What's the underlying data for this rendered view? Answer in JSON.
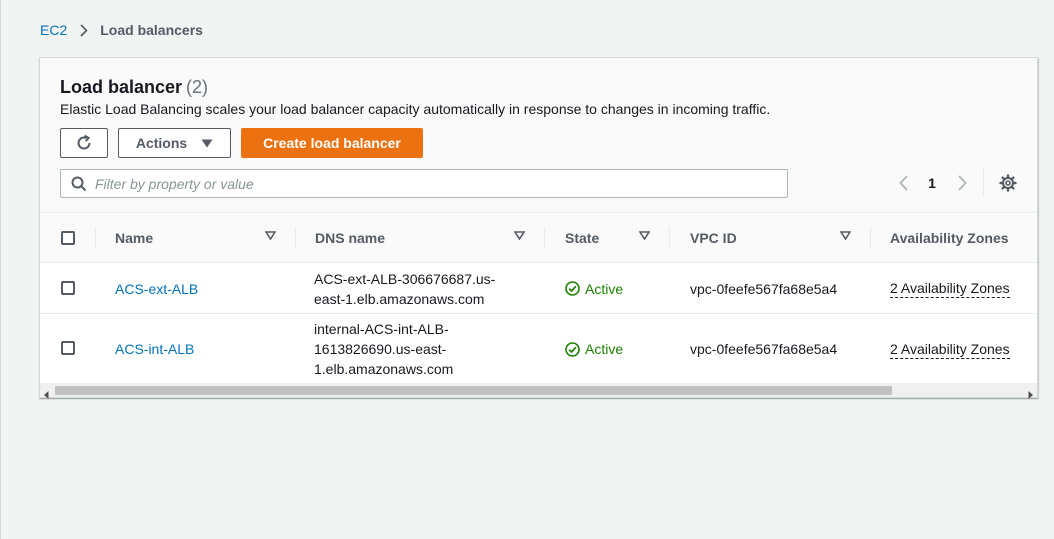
{
  "breadcrumb": {
    "root": "EC2",
    "current": "Load balancers"
  },
  "header": {
    "title": "Load balancer",
    "count": "(2)",
    "description": "Elastic Load Balancing scales your load balancer capacity automatically in response to changes in incoming traffic."
  },
  "toolbar": {
    "refresh_icon": "refresh-icon",
    "actions_label": "Actions",
    "create_label": "Create load balancer"
  },
  "filter": {
    "placeholder": "Filter by property or value"
  },
  "pagination": {
    "current_page": "1"
  },
  "table": {
    "columns": [
      "Name",
      "DNS name",
      "State",
      "VPC ID",
      "Availability Zones"
    ],
    "rows": [
      {
        "name": "ACS-ext-ALB",
        "dns_lines": [
          "ACS-ext-ALB-306676687.us-",
          "east-1.elb.amazonaws.com"
        ],
        "state": "Active",
        "vpc_id": "vpc-0feefe567fa68e5a4",
        "availability_zones": "2 Availability Zones"
      },
      {
        "name": "ACS-int-ALB",
        "dns_lines": [
          "internal-ACS-int-ALB-",
          "1613826690.us-east-",
          "1.elb.amazonaws.com"
        ],
        "state": "Active",
        "vpc_id": "vpc-0feefe567fa68e5a4",
        "availability_zones": "2 Availability Zones"
      }
    ]
  },
  "colors": {
    "accent": "#ec7211",
    "link": "#0073bb",
    "success": "#1d8102",
    "text_secondary": "#545b64"
  }
}
